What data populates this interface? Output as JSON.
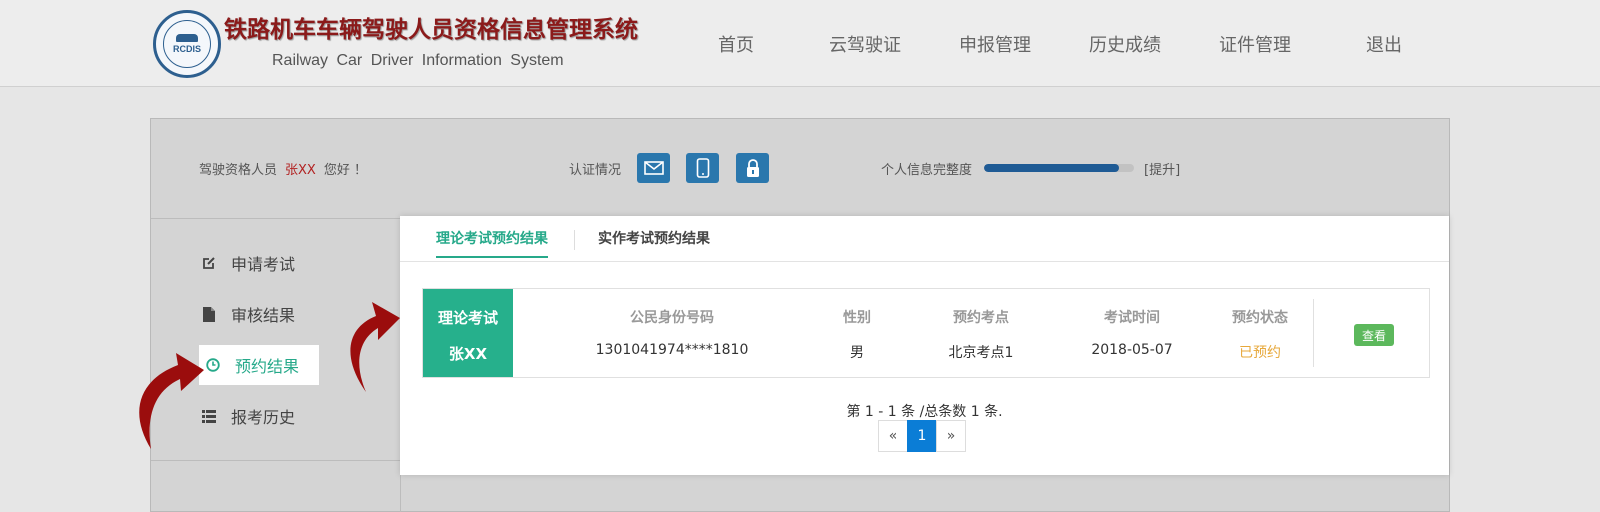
{
  "header": {
    "logo_text": "RCDIS",
    "title_cn": "铁路机车车辆驾驶人员资格信息管理系统",
    "title_en": "Railway  Car  Driver  Information  System",
    "nav": [
      "首页",
      "云驾驶证",
      "申报管理",
      "历史成绩",
      "证件管理",
      "退出"
    ]
  },
  "infobar": {
    "greet_prefix": "驾驶资格人员",
    "user_name": "张XX",
    "greet_suffix": "您好 ！",
    "auth_label": "认证情况",
    "auth_icons": [
      "mail-icon",
      "phone-icon",
      "lock-icon"
    ],
    "progress_label": "个人信息完整度",
    "progress_value": 0.9,
    "progress_link": "[提升]"
  },
  "sidebar": {
    "items": [
      {
        "label": "申请考试",
        "icon": "edit-icon"
      },
      {
        "label": "审核结果",
        "icon": "file-icon"
      },
      {
        "label": "预约结果",
        "icon": "clock-icon",
        "active": true
      },
      {
        "label": "报考历史",
        "icon": "list-icon"
      }
    ]
  },
  "tabs": {
    "theory": "理论考试预约结果",
    "practical": "实作考试预约结果"
  },
  "result": {
    "badge_line1": "理论考试",
    "badge_line2": "张XX",
    "headers": {
      "id": "公民身份号码",
      "gender": "性别",
      "site": "预约考点",
      "time": "考试时间",
      "status": "预约状态"
    },
    "values": {
      "id": "1301041974****1810",
      "gender": "男",
      "site": "北京考点1",
      "time": "2018-05-07",
      "status": "已预约"
    },
    "view_button": "查看"
  },
  "pagination": {
    "info": "第 1 - 1 条 /总条数 1 条.",
    "prev": "«",
    "current": "1",
    "next": "»"
  },
  "colors": {
    "accent": "#26b08c",
    "brand_red": "#8b1a1a",
    "status_pending": "#e7a83b",
    "primary_blue": "#0b7dd6"
  }
}
